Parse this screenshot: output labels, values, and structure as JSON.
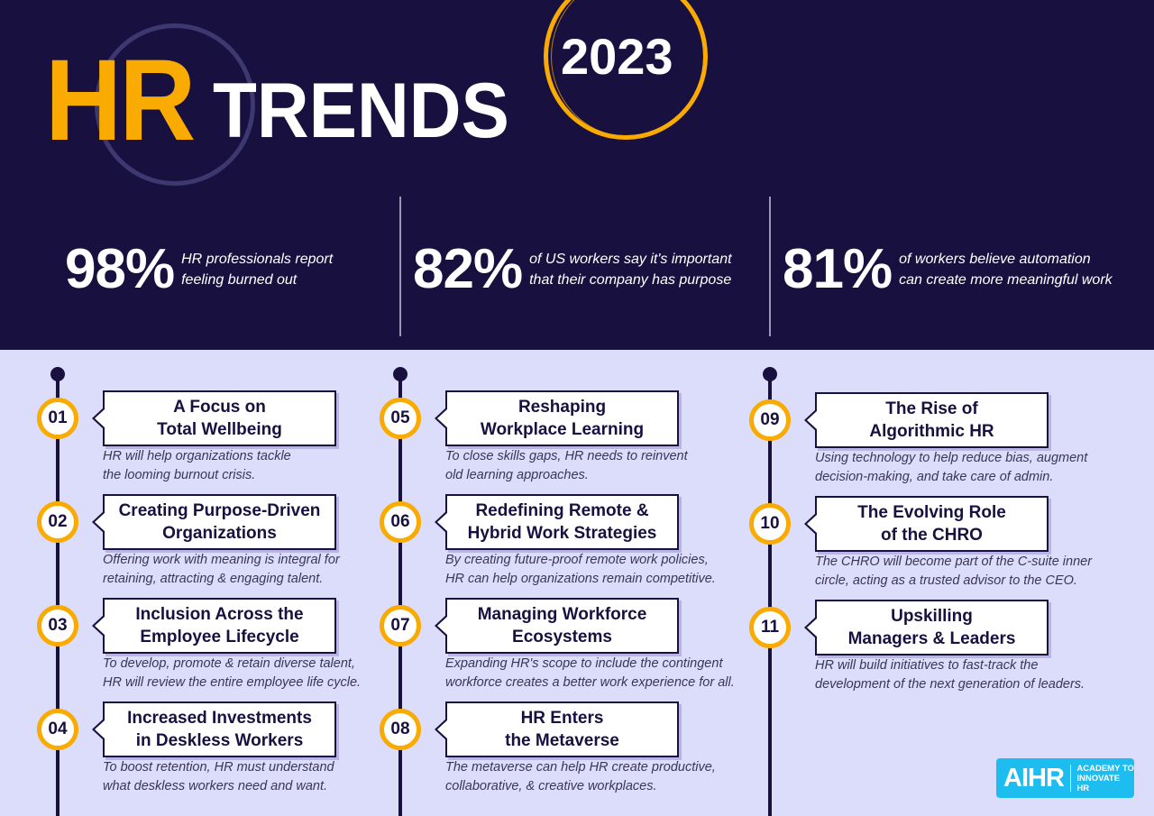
{
  "header": {
    "title_highlight": "HR",
    "title_main": "TRENDS",
    "year": "2023"
  },
  "colors": {
    "navy": "#181140",
    "accent_orange": "#f9ab02",
    "lavender_bg": "#dcdcfb",
    "logo_blue": "#1ebdf0"
  },
  "stats": [
    {
      "value": "98%",
      "lines": [
        "HR professionals report",
        "feeling burned out"
      ]
    },
    {
      "value": "82%",
      "lines": [
        "of US workers say it's important",
        "that their company has purpose"
      ]
    },
    {
      "value": "81%",
      "lines": [
        "of workers believe automation",
        "can create more meaningful work"
      ]
    }
  ],
  "trends": [
    {
      "number": "01",
      "title": [
        "A Focus on",
        "Total Wellbeing"
      ],
      "desc": [
        "HR will help organizations tackle",
        "the looming burnout crisis."
      ]
    },
    {
      "number": "02",
      "title": [
        "Creating Purpose-Driven",
        "Organizations"
      ],
      "desc": [
        "Offering work with meaning is integral for",
        "retaining, attracting & engaging talent."
      ]
    },
    {
      "number": "03",
      "title": [
        "Inclusion Across the",
        "Employee Lifecycle"
      ],
      "desc": [
        "To develop, promote & retain diverse talent,",
        "HR will review the entire employee life cycle."
      ]
    },
    {
      "number": "04",
      "title": [
        "Increased Investments",
        "in Deskless Workers"
      ],
      "desc": [
        "To boost retention, HR must understand",
        "what deskless workers need and want."
      ]
    },
    {
      "number": "05",
      "title": [
        "Reshaping",
        "Workplace Learning"
      ],
      "desc": [
        "To close skills gaps, HR needs to reinvent",
        "old learning approaches."
      ]
    },
    {
      "number": "06",
      "title": [
        "Redefining Remote &",
        "Hybrid Work Strategies"
      ],
      "desc": [
        "By creating future-proof remote work policies,",
        "HR can help organizations remain competitive."
      ]
    },
    {
      "number": "07",
      "title": [
        "Managing Workforce",
        "Ecosystems"
      ],
      "desc": [
        "Expanding HR's scope to include the contingent",
        "workforce creates a better work experience for all."
      ]
    },
    {
      "number": "08",
      "title": [
        "HR Enters",
        "the Metaverse"
      ],
      "desc": [
        "The metaverse can help HR create productive,",
        "collaborative, & creative workplaces."
      ]
    },
    {
      "number": "09",
      "title": [
        "The Rise of",
        "Algorithmic HR"
      ],
      "desc": [
        "Using technology to help reduce bias, augment",
        "decision-making, and take care of admin."
      ]
    },
    {
      "number": "10",
      "title": [
        "The Evolving Role",
        "of the CHRO"
      ],
      "desc": [
        "The CHRO will become part of the C-suite inner",
        "circle, acting as a trusted advisor to the CEO."
      ]
    },
    {
      "number": "11",
      "title": [
        "Upskilling",
        "Managers & Leaders"
      ],
      "desc": [
        "HR will build initiatives to fast-track the",
        "development of the next generation of leaders."
      ]
    }
  ],
  "logo": {
    "main": "AIHR",
    "sub_lines": [
      "ACADEMY TO",
      "INNOVATE HR"
    ]
  }
}
